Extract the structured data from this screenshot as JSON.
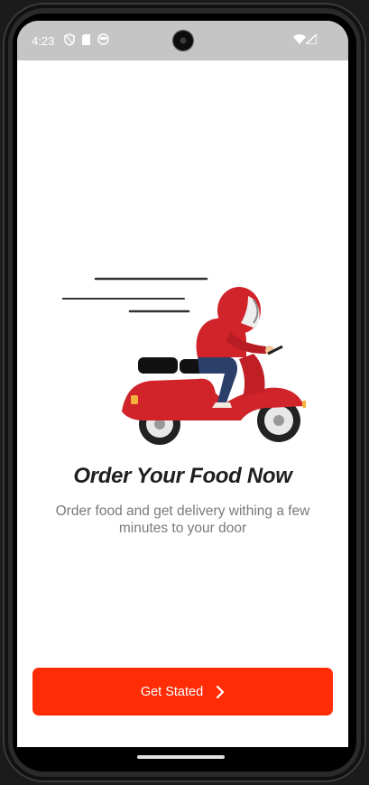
{
  "status_bar": {
    "time": "4:23",
    "left_icons": [
      "shield-icon",
      "sim-card-icon",
      "face-icon"
    ],
    "right_icons": [
      "wifi-icon",
      "cellular-signal-icon"
    ]
  },
  "onboarding": {
    "title": "Order Your Food Now",
    "subtitle": "Order food and get delivery withing a few minutes to your door",
    "illustration": "delivery-scooter-illustration"
  },
  "cta": {
    "label": "Get Stated",
    "icon": "chevron-right-icon",
    "color": "#ff2c06"
  },
  "colors": {
    "accent": "#ff2c06",
    "scooter_red": "#d0232a",
    "status_bar_bg": "#c5c5c5"
  }
}
